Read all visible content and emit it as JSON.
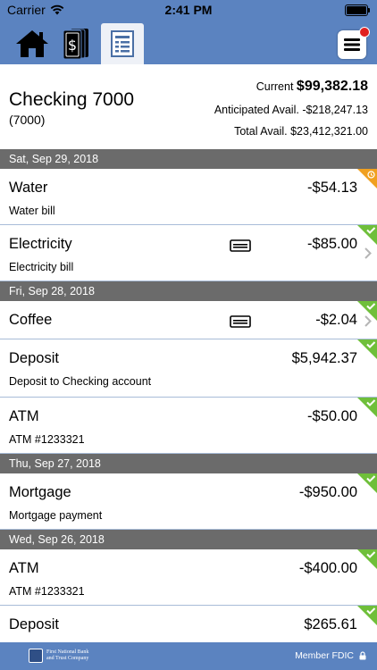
{
  "status_bar": {
    "carrier": "Carrier",
    "time": "2:41 PM"
  },
  "tabs": [
    {
      "icon": "home-icon"
    },
    {
      "icon": "money-icon"
    },
    {
      "icon": "ledger-icon",
      "active": true
    }
  ],
  "account": {
    "name": "Checking 7000",
    "number": "(7000)",
    "current_label": "Current",
    "current_value": "$99,382.18",
    "anticipated_label": "Anticipated Avail.",
    "anticipated_value": "-$218,247.13",
    "total_label": "Total Avail.",
    "total_value": "$23,412,321.00"
  },
  "groups": [
    {
      "date": "Sat, Sep 29, 2018",
      "items": [
        {
          "title": "Water",
          "sub": "Water bill",
          "amount": "-$54.13",
          "status": "pending",
          "card": false,
          "chevron": false
        },
        {
          "title": "Electricity",
          "sub": "Electricity bill",
          "amount": "-$85.00",
          "status": "cleared",
          "card": true,
          "chevron": true
        }
      ]
    },
    {
      "date": "Fri, Sep 28, 2018",
      "items": [
        {
          "title": "Coffee",
          "sub": "",
          "amount": "-$2.04",
          "status": "cleared",
          "card": true,
          "chevron": true
        },
        {
          "title": "Deposit",
          "sub": "Deposit to Checking account",
          "amount": "$5,942.37",
          "status": "cleared",
          "card": false,
          "chevron": false
        },
        {
          "title": "ATM",
          "sub": "ATM #1233321",
          "amount": "-$50.00",
          "status": "cleared",
          "card": false,
          "chevron": false
        }
      ]
    },
    {
      "date": "Thu, Sep 27, 2018",
      "items": [
        {
          "title": "Mortgage",
          "sub": "Mortgage payment",
          "amount": "-$950.00",
          "status": "cleared",
          "card": false,
          "chevron": false
        }
      ]
    },
    {
      "date": "Wed, Sep 26, 2018",
      "items": [
        {
          "title": "ATM",
          "sub": "ATM #1233321",
          "amount": "-$400.00",
          "status": "cleared",
          "card": false,
          "chevron": false
        },
        {
          "title": "Deposit",
          "sub": "",
          "amount": "$265.61",
          "status": "cleared",
          "card": false,
          "chevron": false
        }
      ]
    }
  ],
  "footer": {
    "bank_name_line1": "First National Bank",
    "bank_name_line2": "and Trust Company",
    "member_fdic": "Member FDIC"
  },
  "colors": {
    "brand": "#5b83c0",
    "date_header": "#6b6b6b",
    "cleared": "#6fbf3a",
    "pending": "#f0a020"
  }
}
